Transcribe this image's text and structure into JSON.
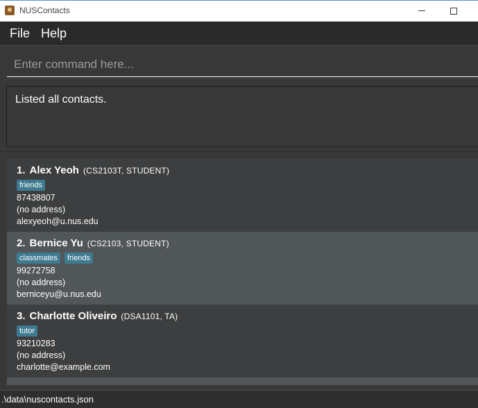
{
  "window": {
    "title": "NUSContacts"
  },
  "menu": {
    "items": [
      "File",
      "Help"
    ]
  },
  "command": {
    "placeholder": "Enter command here..."
  },
  "result": {
    "text": "Listed all contacts."
  },
  "contacts": [
    {
      "index": "1.",
      "name": "Alex Yeoh",
      "roles": "(CS2103T, STUDENT)",
      "tags": [
        "friends"
      ],
      "phone": "87438807",
      "address": "(no address)",
      "email": "alexyeoh@u.nus.edu"
    },
    {
      "index": "2.",
      "name": "Bernice Yu",
      "roles": "(CS2103, STUDENT)",
      "tags": [
        "classmates",
        "friends"
      ],
      "phone": "99272758",
      "address": "(no address)",
      "email": "berniceyu@u.nus.edu"
    },
    {
      "index": "3.",
      "name": "Charlotte Oliveiro",
      "roles": "(DSA1101, TA)",
      "tags": [
        "tutor"
      ],
      "phone": "93210283",
      "address": "(no address)",
      "email": "charlotte@example.com"
    }
  ],
  "status": {
    "path": ".\\data\\nuscontacts.json"
  },
  "colors": {
    "tag": "#3e7b91",
    "background": "#383838",
    "card_alt": "#515658"
  }
}
